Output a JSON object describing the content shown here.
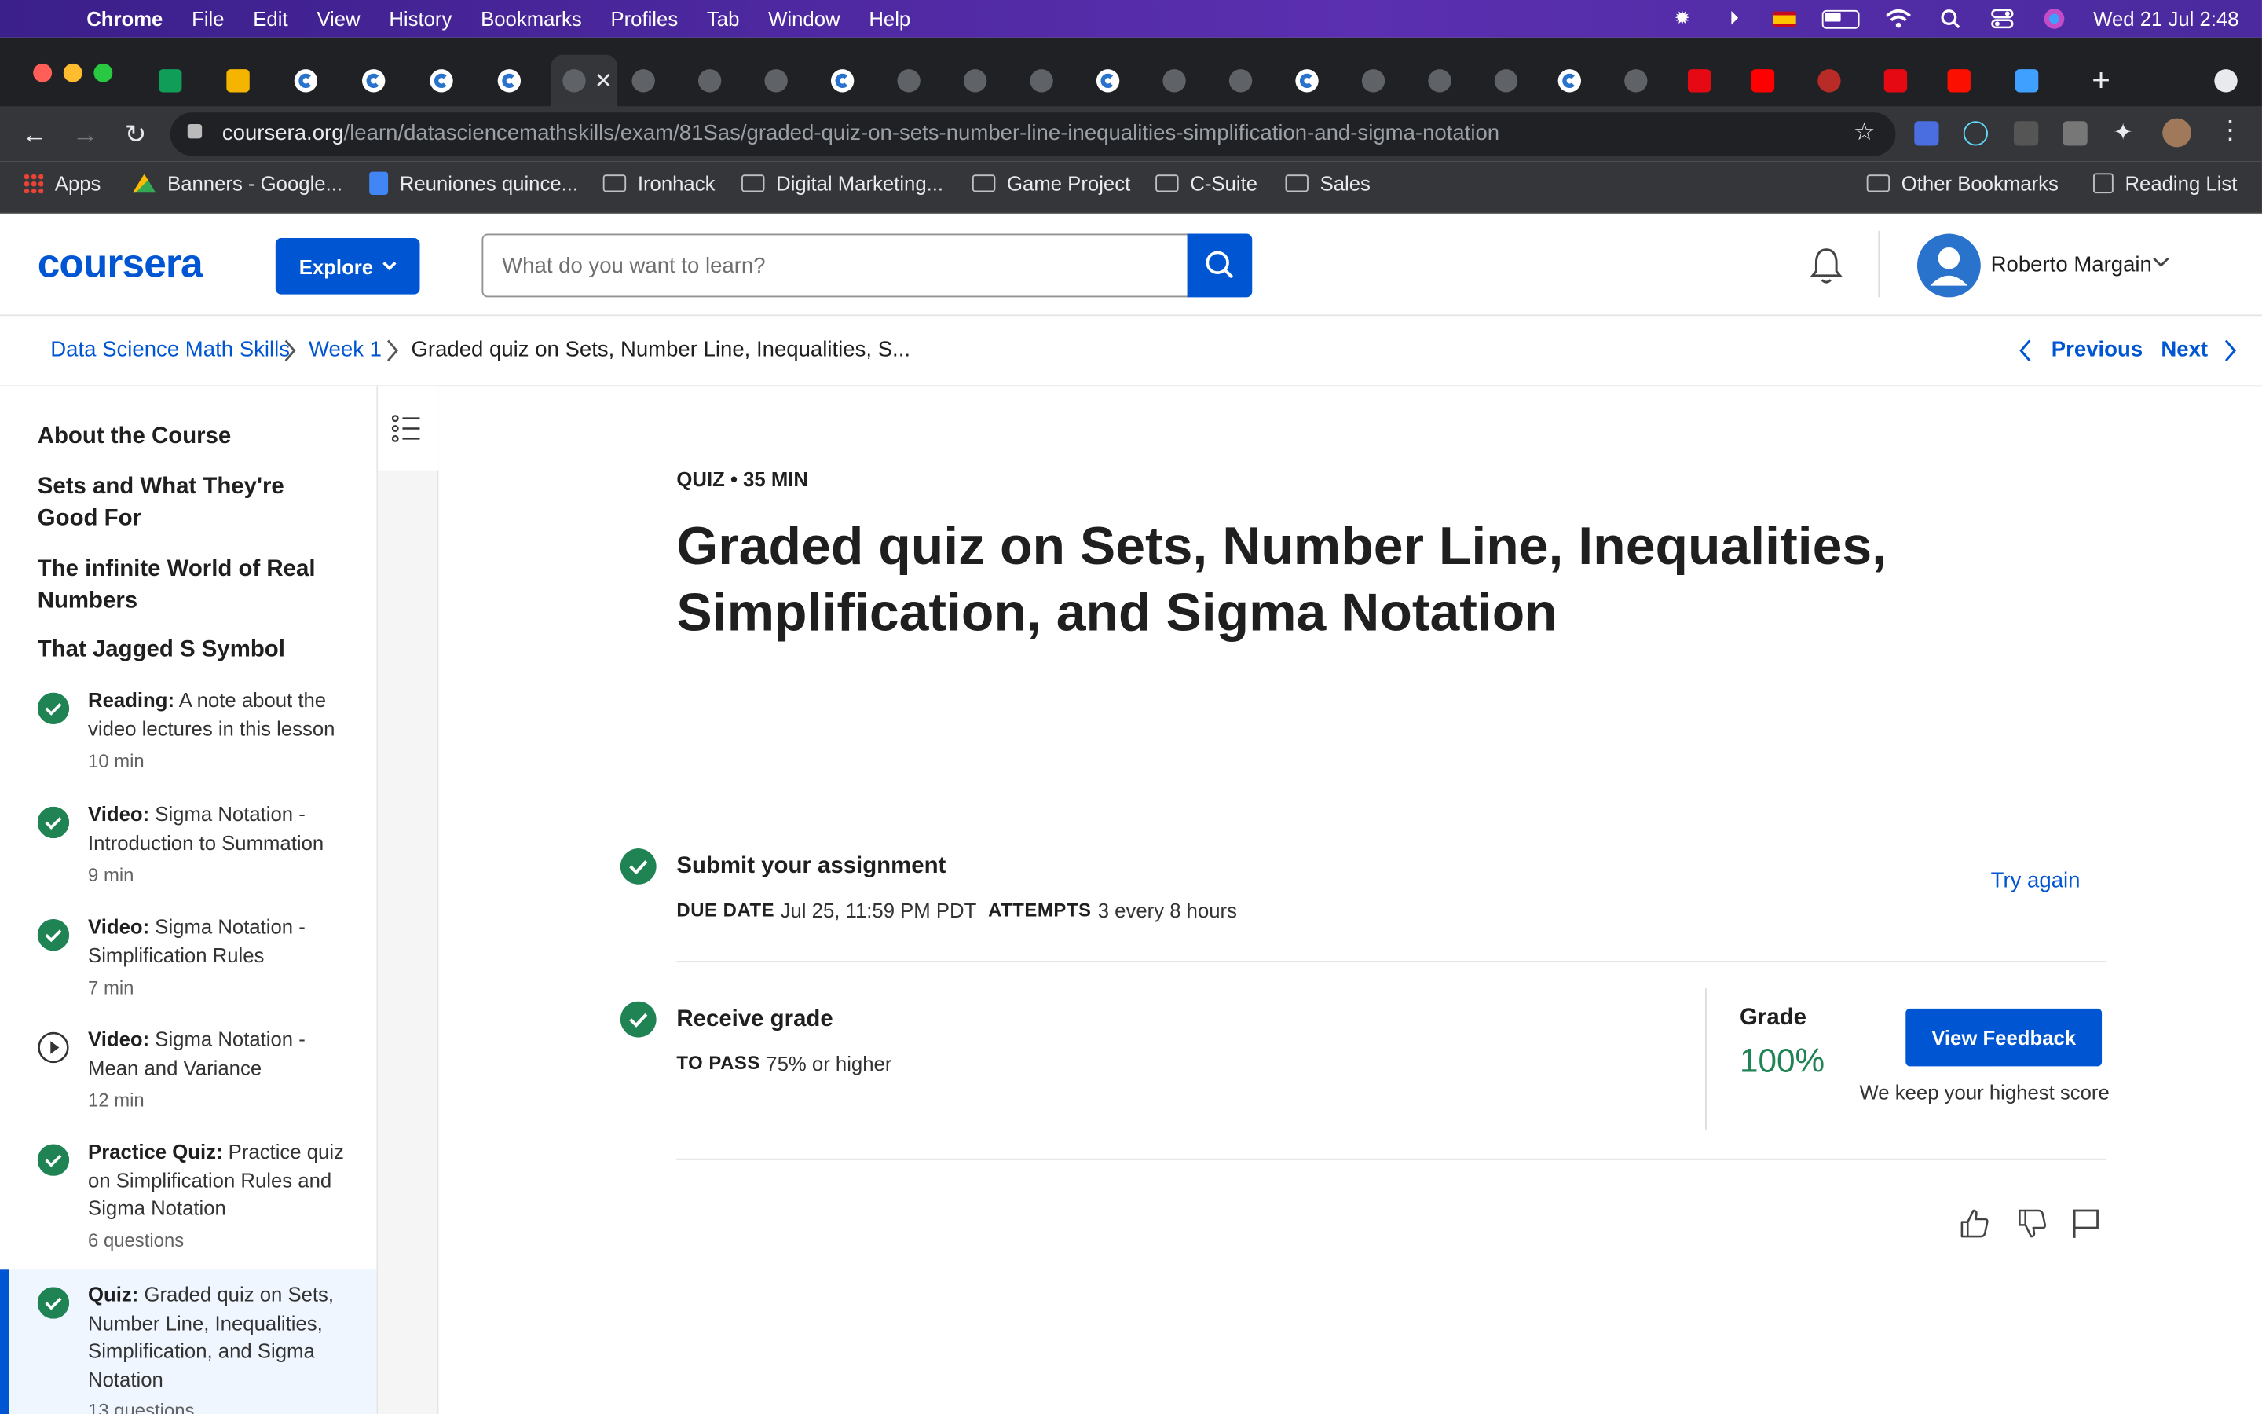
{
  "menubar": {
    "app": "Chrome",
    "items": [
      "File",
      "Edit",
      "View",
      "History",
      "Bookmarks",
      "Profiles",
      "Tab",
      "Window",
      "Help"
    ],
    "clock": "Wed 21 Jul  2:48"
  },
  "browser": {
    "url_host": "coursera.org",
    "url_path": "/learn/datasciencemathskills/exam/81Sas/graded-quiz-on-sets-number-line-inequalities-simplification-and-sigma-notation",
    "bookmarks": [
      "Apps",
      "Banners - Google...",
      "Reuniones quince...",
      "Ironhack",
      "Digital Marketing...",
      "Game Project",
      "C-Suite",
      "Sales"
    ],
    "other_bookmarks": "Other Bookmarks",
    "reading_list": "Reading List"
  },
  "header": {
    "logo": "coursera",
    "explore": "Explore",
    "search_placeholder": "What do you want to learn?",
    "user_name": "Roberto Margain"
  },
  "breadcrumb": {
    "course": "Data Science Math Skills",
    "week": "Week 1",
    "current": "Graded quiz on Sets, Number Line, Inequalities, S...",
    "previous": "Previous",
    "next": "Next"
  },
  "sidebar": {
    "sections": [
      "About the Course",
      "Sets and What They're Good For",
      "The infinite World of Real Numbers",
      "That Jagged S Symbol"
    ],
    "items": [
      {
        "type": "Reading:",
        "title": "A note about the video lectures in this lesson",
        "meta": "10 min",
        "status": "done"
      },
      {
        "type": "Video:",
        "title": "Sigma Notation - Introduction to Summation",
        "meta": "9 min",
        "status": "done"
      },
      {
        "type": "Video:",
        "title": "Sigma Notation - Simplification Rules",
        "meta": "7 min",
        "status": "done"
      },
      {
        "type": "Video:",
        "title": "Sigma Notation - Mean and Variance",
        "meta": "12 min",
        "status": "play"
      },
      {
        "type": "Practice Quiz:",
        "title": "Practice quiz on Simplification Rules and Sigma Notation",
        "meta": "6 questions",
        "status": "done"
      },
      {
        "type": "Quiz:",
        "title": "Graded quiz on Sets, Number Line, Inequalities, Simplification, and Sigma Notation",
        "meta": "13 questions",
        "status": "done"
      }
    ]
  },
  "main": {
    "meta": "QUIZ • 35 MIN",
    "title": "Graded quiz on Sets, Number Line, Inequalities, Simplification, and Sigma Notation",
    "submit": {
      "heading": "Submit your assignment",
      "due_label": "DUE DATE",
      "due_value": "Jul 25, 11:59 PM PDT",
      "attempts_label": "ATTEMPTS",
      "attempts_value": "3 every 8 hours",
      "try_again": "Try again"
    },
    "receive": {
      "heading": "Receive grade",
      "pass_label": "TO PASS",
      "pass_value": "75% or higher",
      "grade_label": "Grade",
      "grade_value": "100%",
      "view_feedback": "View Feedback",
      "note": "We keep your highest score"
    }
  },
  "colors": {
    "brand": "#0056d2",
    "success": "#1f8354"
  }
}
